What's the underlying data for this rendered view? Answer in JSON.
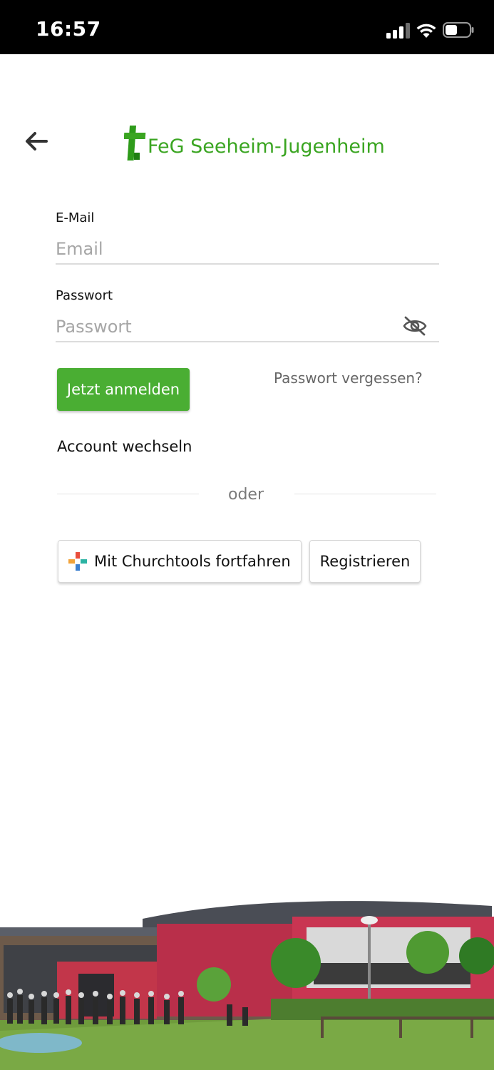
{
  "status_bar": {
    "time": "16:57"
  },
  "header": {
    "logo_text": "FeG Seeheim-Jugenheim"
  },
  "form": {
    "email_label": "E-Mail",
    "email_placeholder": "Email",
    "email_value": "",
    "password_label": "Passwort",
    "password_placeholder": "Passwort",
    "password_value": "",
    "login_button": "Jetzt anmelden",
    "forgot_link": "Passwort vergessen?",
    "switch_account": "Account wechseln",
    "divider_text": "oder",
    "churchtools_button": "Mit Churchtools fortfahren",
    "register_button": "Registrieren"
  },
  "colors": {
    "brand_green": "#3aa521",
    "button_green": "#4aae33"
  },
  "icons": [
    "back-arrow-icon",
    "cross-logo-icon",
    "eye-off-icon",
    "churchtools-icon",
    "cellular-signal-icon",
    "wifi-icon",
    "battery-icon"
  ]
}
